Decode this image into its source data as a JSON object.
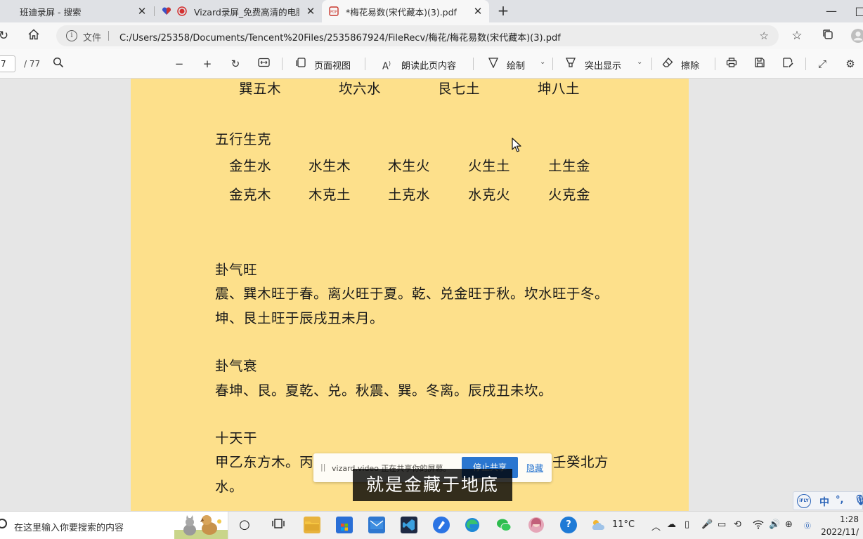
{
  "tabs": [
    {
      "title": "班迪录屏 - 搜索",
      "favicon": "search-favicon"
    },
    {
      "title": "Vizard录屏_免费高清的电脑",
      "favicon": "vizard-favicon"
    },
    {
      "title": "*梅花易数(宋代藏本)(3).pdf",
      "favicon": "pdf-favicon"
    }
  ],
  "address": {
    "file_label": "文件",
    "url": "C:/Users/25358/Documents/Tencent%20Files/2535867924/FileRecv/梅花/梅花易数(宋代藏本)(3).pdf"
  },
  "pdf_toolbar": {
    "page_current": "7",
    "page_total": "/ 77",
    "page_view": "页面视图",
    "read_aloud": "朗读此页内容",
    "draw": "绘制",
    "highlight": "突出显示",
    "erase": "擦除"
  },
  "document": {
    "trigram_row": [
      "巽五木",
      "坎六水",
      "艮七土",
      "坤八土"
    ],
    "wuxing_heading": "五行生克",
    "sheng_row": [
      "金生水",
      "水生木",
      "木生火",
      "火生土",
      "土生金"
    ],
    "ke_row": [
      "金克木",
      "木克土",
      "土克水",
      "水克火",
      "火克金"
    ],
    "wang_heading": "卦气旺",
    "wang_line1": "震、巽木旺于春。离火旺于夏。乾、兑金旺于秋。坎水旺于冬。",
    "wang_line2": "坤、艮土旺于辰戌丑未月。",
    "shuai_heading": "卦气衰",
    "shuai_line": "春坤、艮。夏乾、兑。秋震、巽。冬离。辰戌丑未坎。",
    "tiangan_heading": "十天干",
    "tiangan_line1_start": "甲乙东方木。丙",
    "tiangan_line1_end": "壬癸北方",
    "tiangan_line2": "水。"
  },
  "sharing_bar": {
    "text": "vizard.video 正在共享你的屏幕。",
    "stop_label": "停止共享",
    "hide_label": "隐藏"
  },
  "subtitle": "就是金藏于地底",
  "ime": {
    "logo": "iFLY",
    "lang": "中"
  },
  "taskbar": {
    "search_placeholder": "在这里输入你要搜索的内容",
    "weather": "11°C",
    "time": "1:28",
    "date": "2022/11/"
  }
}
